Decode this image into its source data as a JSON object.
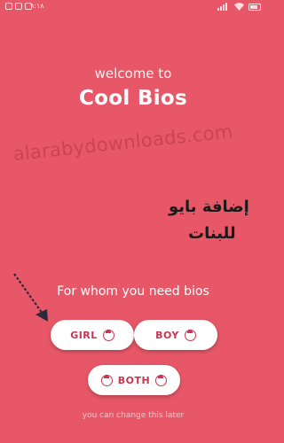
{
  "statusbar": {
    "time": "۹:۱۸"
  },
  "welcome": "welcome to",
  "app_title": "Cool Bios",
  "watermark": "alarabydownloads.com",
  "annotation": {
    "line1": "إضافة بايو",
    "line2": "للبنات"
  },
  "question": "For whom you need bios",
  "buttons": {
    "girl": "GIRL",
    "boy": "BOY",
    "both": "BOTH"
  },
  "footer": "you can change this later",
  "colors": {
    "background": "#e75768",
    "button": "#ffffff",
    "button_text": "#c63651"
  }
}
